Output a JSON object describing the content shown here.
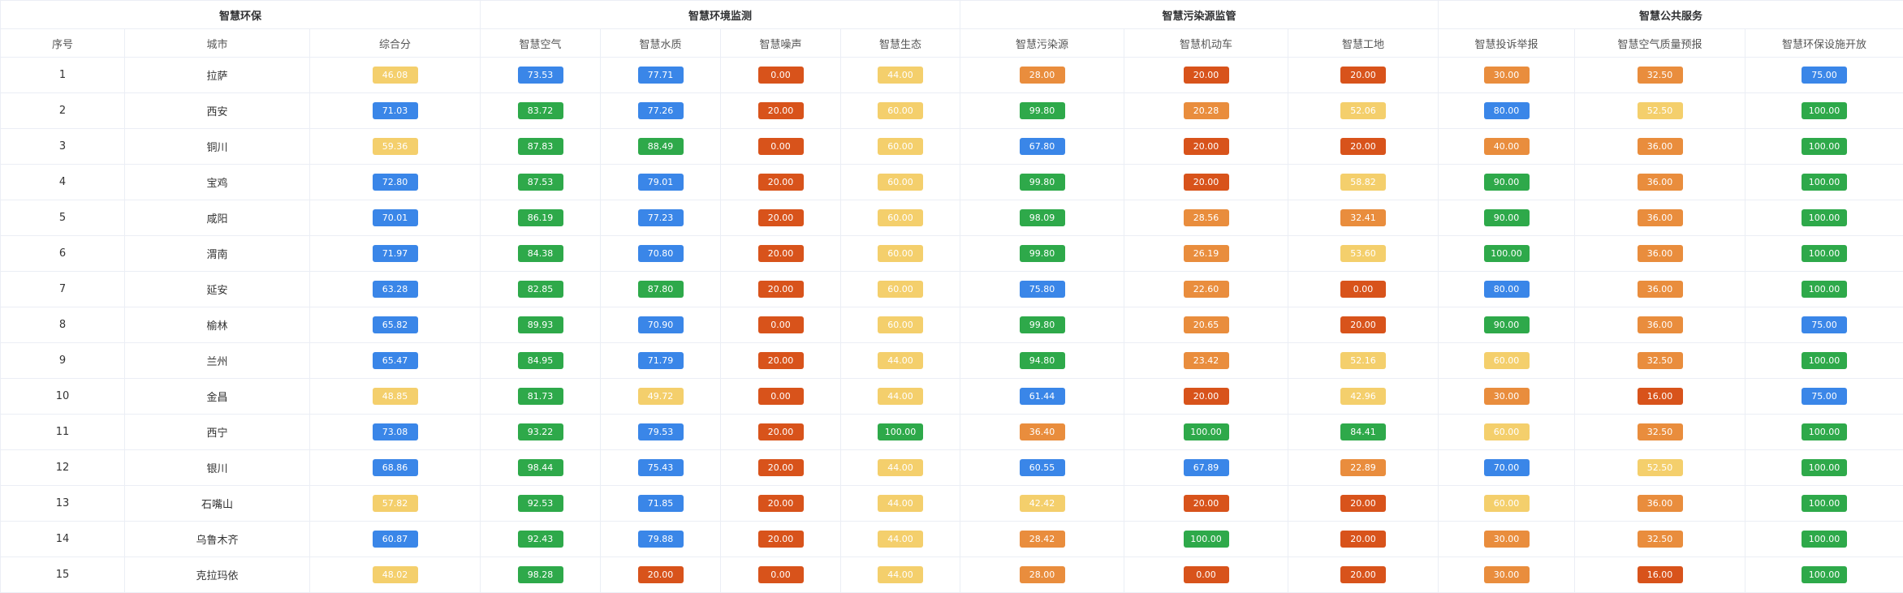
{
  "colors": {
    "blue": "#3a86e8",
    "green": "#2ea94a",
    "red": "#d8531b",
    "orange": "#e98d3d",
    "yellow": "#f4cf6c"
  },
  "groups": [
    "智慧环保",
    "智慧环境监测",
    "智慧污染源监管",
    "智慧公共服务"
  ],
  "columns": [
    "序号",
    "城市",
    "综合分",
    "智慧空气",
    "智慧水质",
    "智慧噪声",
    "智慧生态",
    "智慧污染源",
    "智慧机动车",
    "智慧工地",
    "智慧投诉举报",
    "智慧空气质量预报",
    "智慧环保设施开放"
  ],
  "rows": [
    {
      "no": "1",
      "city": "拉萨",
      "cells": [
        [
          "46.08",
          "yellow"
        ],
        [
          "73.53",
          "blue"
        ],
        [
          "77.71",
          "blue"
        ],
        [
          "0.00",
          "red"
        ],
        [
          "44.00",
          "yellow"
        ],
        [
          "28.00",
          "orange"
        ],
        [
          "20.00",
          "red"
        ],
        [
          "20.00",
          "red"
        ],
        [
          "30.00",
          "orange"
        ],
        [
          "32.50",
          "orange"
        ],
        [
          "75.00",
          "blue"
        ]
      ]
    },
    {
      "no": "2",
      "city": "西安",
      "cells": [
        [
          "71.03",
          "blue"
        ],
        [
          "83.72",
          "green"
        ],
        [
          "77.26",
          "blue"
        ],
        [
          "20.00",
          "red"
        ],
        [
          "60.00",
          "yellow"
        ],
        [
          "99.80",
          "green"
        ],
        [
          "20.28",
          "orange"
        ],
        [
          "52.06",
          "yellow"
        ],
        [
          "80.00",
          "blue"
        ],
        [
          "52.50",
          "yellow"
        ],
        [
          "100.00",
          "green"
        ]
      ]
    },
    {
      "no": "3",
      "city": "铜川",
      "cells": [
        [
          "59.36",
          "yellow"
        ],
        [
          "87.83",
          "green"
        ],
        [
          "88.49",
          "green"
        ],
        [
          "0.00",
          "red"
        ],
        [
          "60.00",
          "yellow"
        ],
        [
          "67.80",
          "blue"
        ],
        [
          "20.00",
          "red"
        ],
        [
          "20.00",
          "red"
        ],
        [
          "40.00",
          "orange"
        ],
        [
          "36.00",
          "orange"
        ],
        [
          "100.00",
          "green"
        ]
      ]
    },
    {
      "no": "4",
      "city": "宝鸡",
      "cells": [
        [
          "72.80",
          "blue"
        ],
        [
          "87.53",
          "green"
        ],
        [
          "79.01",
          "blue"
        ],
        [
          "20.00",
          "red"
        ],
        [
          "60.00",
          "yellow"
        ],
        [
          "99.80",
          "green"
        ],
        [
          "20.00",
          "red"
        ],
        [
          "58.82",
          "yellow"
        ],
        [
          "90.00",
          "green"
        ],
        [
          "36.00",
          "orange"
        ],
        [
          "100.00",
          "green"
        ]
      ]
    },
    {
      "no": "5",
      "city": "咸阳",
      "cells": [
        [
          "70.01",
          "blue"
        ],
        [
          "86.19",
          "green"
        ],
        [
          "77.23",
          "blue"
        ],
        [
          "20.00",
          "red"
        ],
        [
          "60.00",
          "yellow"
        ],
        [
          "98.09",
          "green"
        ],
        [
          "28.56",
          "orange"
        ],
        [
          "32.41",
          "orange"
        ],
        [
          "90.00",
          "green"
        ],
        [
          "36.00",
          "orange"
        ],
        [
          "100.00",
          "green"
        ]
      ]
    },
    {
      "no": "6",
      "city": "渭南",
      "cells": [
        [
          "71.97",
          "blue"
        ],
        [
          "84.38",
          "green"
        ],
        [
          "70.80",
          "blue"
        ],
        [
          "20.00",
          "red"
        ],
        [
          "60.00",
          "yellow"
        ],
        [
          "99.80",
          "green"
        ],
        [
          "26.19",
          "orange"
        ],
        [
          "53.60",
          "yellow"
        ],
        [
          "100.00",
          "green"
        ],
        [
          "36.00",
          "orange"
        ],
        [
          "100.00",
          "green"
        ]
      ]
    },
    {
      "no": "7",
      "city": "延安",
      "cells": [
        [
          "63.28",
          "blue"
        ],
        [
          "82.85",
          "green"
        ],
        [
          "87.80",
          "green"
        ],
        [
          "20.00",
          "red"
        ],
        [
          "60.00",
          "yellow"
        ],
        [
          "75.80",
          "blue"
        ],
        [
          "22.60",
          "orange"
        ],
        [
          "0.00",
          "red"
        ],
        [
          "80.00",
          "blue"
        ],
        [
          "36.00",
          "orange"
        ],
        [
          "100.00",
          "green"
        ]
      ]
    },
    {
      "no": "8",
      "city": "榆林",
      "cells": [
        [
          "65.82",
          "blue"
        ],
        [
          "89.93",
          "green"
        ],
        [
          "70.90",
          "blue"
        ],
        [
          "0.00",
          "red"
        ],
        [
          "60.00",
          "yellow"
        ],
        [
          "99.80",
          "green"
        ],
        [
          "20.65",
          "orange"
        ],
        [
          "20.00",
          "red"
        ],
        [
          "90.00",
          "green"
        ],
        [
          "36.00",
          "orange"
        ],
        [
          "75.00",
          "blue"
        ]
      ]
    },
    {
      "no": "9",
      "city": "兰州",
      "cells": [
        [
          "65.47",
          "blue"
        ],
        [
          "84.95",
          "green"
        ],
        [
          "71.79",
          "blue"
        ],
        [
          "20.00",
          "red"
        ],
        [
          "44.00",
          "yellow"
        ],
        [
          "94.80",
          "green"
        ],
        [
          "23.42",
          "orange"
        ],
        [
          "52.16",
          "yellow"
        ],
        [
          "60.00",
          "yellow"
        ],
        [
          "32.50",
          "orange"
        ],
        [
          "100.00",
          "green"
        ]
      ]
    },
    {
      "no": "10",
      "city": "金昌",
      "cells": [
        [
          "48.85",
          "yellow"
        ],
        [
          "81.73",
          "green"
        ],
        [
          "49.72",
          "yellow"
        ],
        [
          "0.00",
          "red"
        ],
        [
          "44.00",
          "yellow"
        ],
        [
          "61.44",
          "blue"
        ],
        [
          "20.00",
          "red"
        ],
        [
          "42.96",
          "yellow"
        ],
        [
          "30.00",
          "orange"
        ],
        [
          "16.00",
          "red"
        ],
        [
          "75.00",
          "blue"
        ]
      ]
    },
    {
      "no": "11",
      "city": "西宁",
      "cells": [
        [
          "73.08",
          "blue"
        ],
        [
          "93.22",
          "green"
        ],
        [
          "79.53",
          "blue"
        ],
        [
          "20.00",
          "red"
        ],
        [
          "100.00",
          "green"
        ],
        [
          "36.40",
          "orange"
        ],
        [
          "100.00",
          "green"
        ],
        [
          "84.41",
          "green"
        ],
        [
          "60.00",
          "yellow"
        ],
        [
          "32.50",
          "orange"
        ],
        [
          "100.00",
          "green"
        ]
      ]
    },
    {
      "no": "12",
      "city": "银川",
      "cells": [
        [
          "68.86",
          "blue"
        ],
        [
          "98.44",
          "green"
        ],
        [
          "75.43",
          "blue"
        ],
        [
          "20.00",
          "red"
        ],
        [
          "44.00",
          "yellow"
        ],
        [
          "60.55",
          "blue"
        ],
        [
          "67.89",
          "blue"
        ],
        [
          "22.89",
          "orange"
        ],
        [
          "70.00",
          "blue"
        ],
        [
          "52.50",
          "yellow"
        ],
        [
          "100.00",
          "green"
        ]
      ]
    },
    {
      "no": "13",
      "city": "石嘴山",
      "cells": [
        [
          "57.82",
          "yellow"
        ],
        [
          "92.53",
          "green"
        ],
        [
          "71.85",
          "blue"
        ],
        [
          "20.00",
          "red"
        ],
        [
          "44.00",
          "yellow"
        ],
        [
          "42.42",
          "yellow"
        ],
        [
          "20.00",
          "red"
        ],
        [
          "20.00",
          "red"
        ],
        [
          "60.00",
          "yellow"
        ],
        [
          "36.00",
          "orange"
        ],
        [
          "100.00",
          "green"
        ]
      ]
    },
    {
      "no": "14",
      "city": "乌鲁木齐",
      "cells": [
        [
          "60.87",
          "blue"
        ],
        [
          "92.43",
          "green"
        ],
        [
          "79.88",
          "blue"
        ],
        [
          "20.00",
          "red"
        ],
        [
          "44.00",
          "yellow"
        ],
        [
          "28.42",
          "orange"
        ],
        [
          "100.00",
          "green"
        ],
        [
          "20.00",
          "red"
        ],
        [
          "30.00",
          "orange"
        ],
        [
          "32.50",
          "orange"
        ],
        [
          "100.00",
          "green"
        ]
      ]
    },
    {
      "no": "15",
      "city": "克拉玛依",
      "cells": [
        [
          "48.02",
          "yellow"
        ],
        [
          "98.28",
          "green"
        ],
        [
          "20.00",
          "red"
        ],
        [
          "0.00",
          "red"
        ],
        [
          "44.00",
          "yellow"
        ],
        [
          "28.00",
          "orange"
        ],
        [
          "0.00",
          "red"
        ],
        [
          "20.00",
          "red"
        ],
        [
          "30.00",
          "orange"
        ],
        [
          "16.00",
          "red"
        ],
        [
          "100.00",
          "green"
        ]
      ]
    }
  ]
}
